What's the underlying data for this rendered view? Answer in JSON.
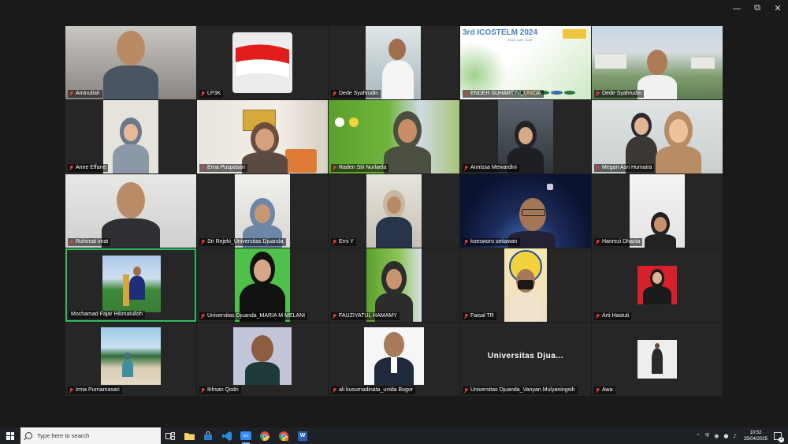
{
  "window_controls": {
    "minimize": "—",
    "maximize": "⧉",
    "close": "✕"
  },
  "participants": [
    {
      "name": "Aminullah"
    },
    {
      "name": "LP3K"
    },
    {
      "name": "Dede Syahrudin"
    },
    {
      "name": "ENDEH SUHARTINI_UNIDA"
    },
    {
      "name": "Dede Syahrudin"
    },
    {
      "name": "Anne Effane"
    },
    {
      "name": "Erna Puspasari"
    },
    {
      "name": "Raden Siti Nurlaela"
    },
    {
      "name": "Annissa Mewardini"
    },
    {
      "name": "Megan Asri Humaira"
    },
    {
      "name": "Ruhimat imat"
    },
    {
      "name": "Sri Rejeki_Universitas Djuanda"
    },
    {
      "name": "Erni Y"
    },
    {
      "name": "koesworo setiawan"
    },
    {
      "name": "Hanrezi Dhania"
    },
    {
      "name": "Mochamad Fajar Hikmatulloh"
    },
    {
      "name": "Universitas Djuanda_MARIA M MELANI"
    },
    {
      "name": "FAUZIYATUL HAMAMY"
    },
    {
      "name": "Faisal TR"
    },
    {
      "name": "Arti Hastuti"
    },
    {
      "name": "Irma Purnamasari"
    },
    {
      "name": "Ikhsan Qodri"
    },
    {
      "name": "ali kusumadinata_unida Bogor"
    },
    {
      "name": "Universitas Djuanda_Vanyan Mulyaningsih",
      "display_name": "Universitas  Djua..."
    },
    {
      "name": "Awa"
    }
  ],
  "conference_banner": {
    "title": "3rd ICOSTELM 2024",
    "subtitle": "23-24 June, 2024"
  },
  "taskbar": {
    "search_placeholder": "Type here to search",
    "apps": [
      "task-view",
      "file-explorer",
      "store",
      "vscode",
      "zoom",
      "chrome",
      "chrome-profile",
      "word"
    ],
    "time": "10:52",
    "date": "25/04/2025",
    "notification_count": "3"
  },
  "colors": {
    "active_speaker": "#2fbd5c",
    "muted_mic": "#e23b3b",
    "taskbar": "#1e2126"
  }
}
